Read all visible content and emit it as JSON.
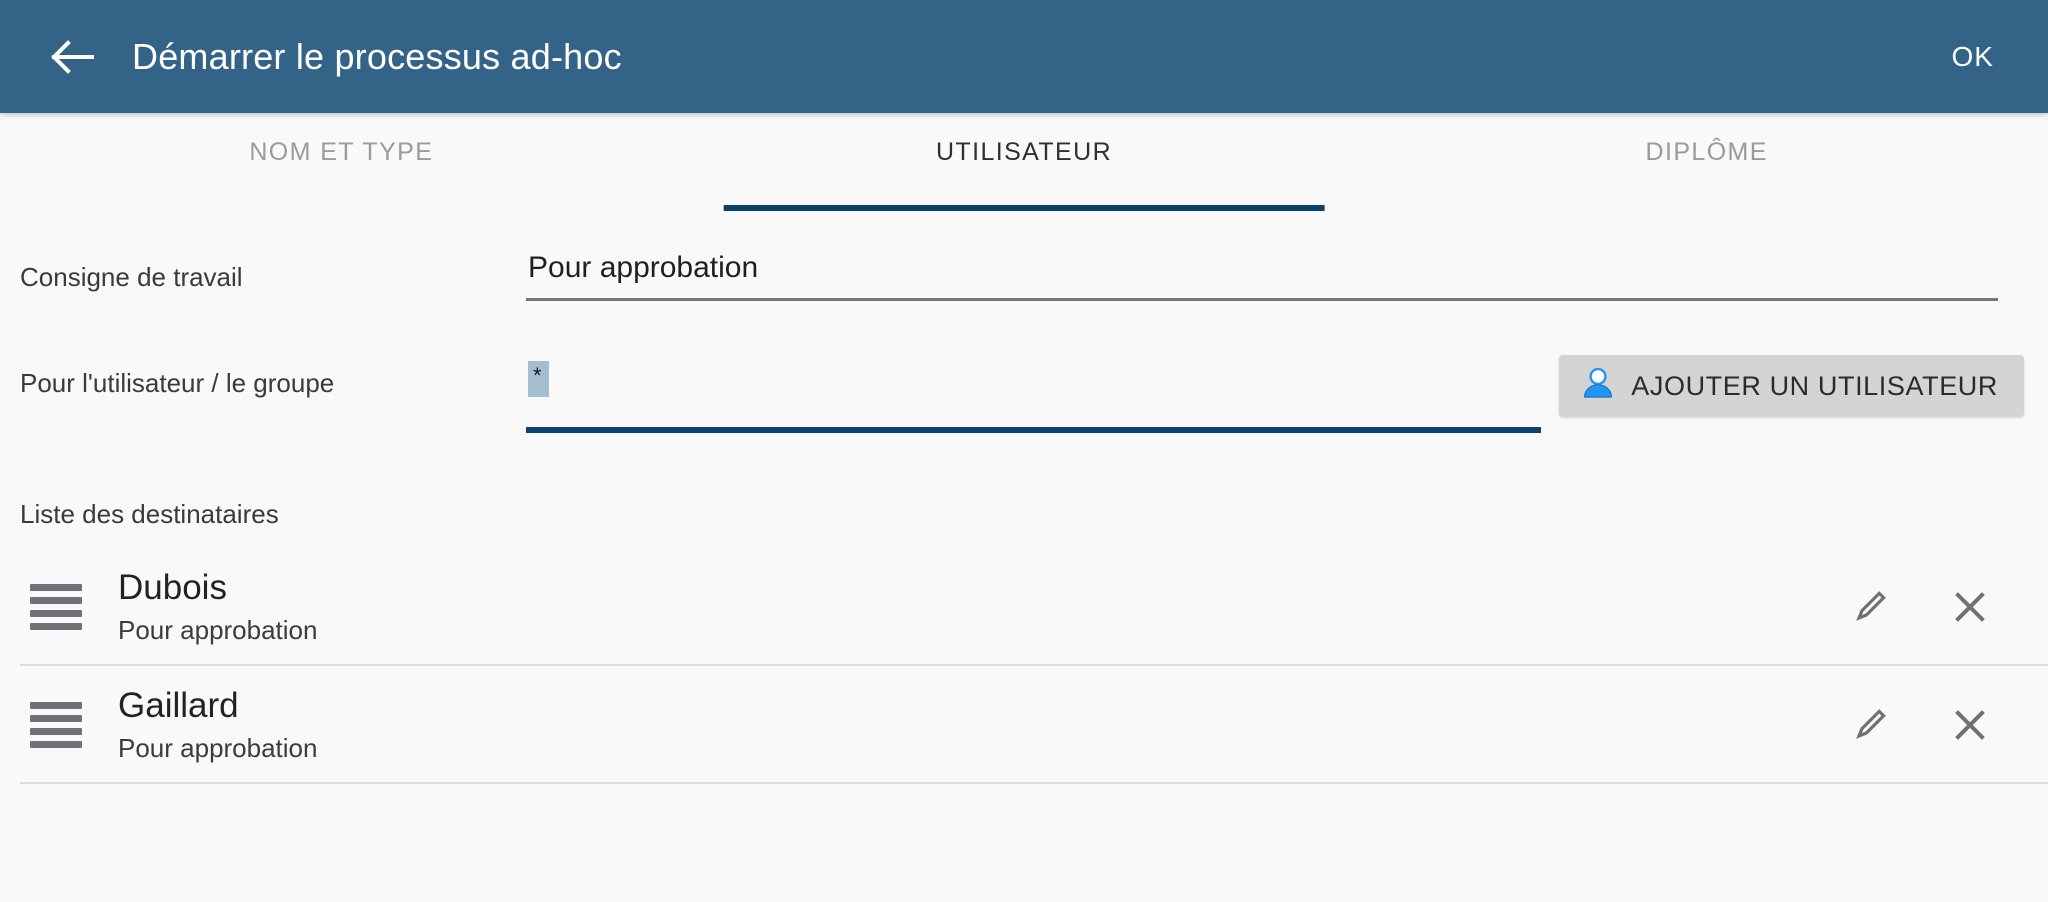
{
  "appbar": {
    "back_icon": "arrow-left-icon",
    "title": "Démarrer le processus ad-hoc",
    "confirm_label": "OK",
    "background_color": "#336488",
    "text_color": "#ffffff"
  },
  "tabs": {
    "active_index": 1,
    "indicator_color": "#0d4070",
    "items": [
      {
        "label": "NOM ET TYPE"
      },
      {
        "label": "UTILISATEUR"
      },
      {
        "label": "DIPLÔME"
      }
    ]
  },
  "form": {
    "consigne": {
      "label": "Consigne de travail",
      "value": "Pour approbation",
      "placeholder": ""
    },
    "user_group": {
      "label": "Pour l'utilisateur / le groupe",
      "value": "*",
      "placeholder": "",
      "selected": true,
      "selection_color": "#a3bdd1",
      "focus_color": "#0d4070"
    },
    "add_user_button": {
      "label": "AJOUTER UN UTILISATEUR",
      "icon": "person-add-icon",
      "background_color": "#d4d4d4",
      "icon_color": "#2196f3"
    }
  },
  "recipients_section": {
    "title": "Liste des destinataires",
    "items": [
      {
        "drag_icon": "drag-handle-icon",
        "name": "Dubois",
        "subtitle": "Pour approbation",
        "edit_icon": "pencil-icon",
        "delete_icon": "close-icon"
      },
      {
        "drag_icon": "drag-handle-icon",
        "name": "Gaillard",
        "subtitle": "Pour approbation",
        "edit_icon": "pencil-icon",
        "delete_icon": "close-icon"
      }
    ]
  }
}
